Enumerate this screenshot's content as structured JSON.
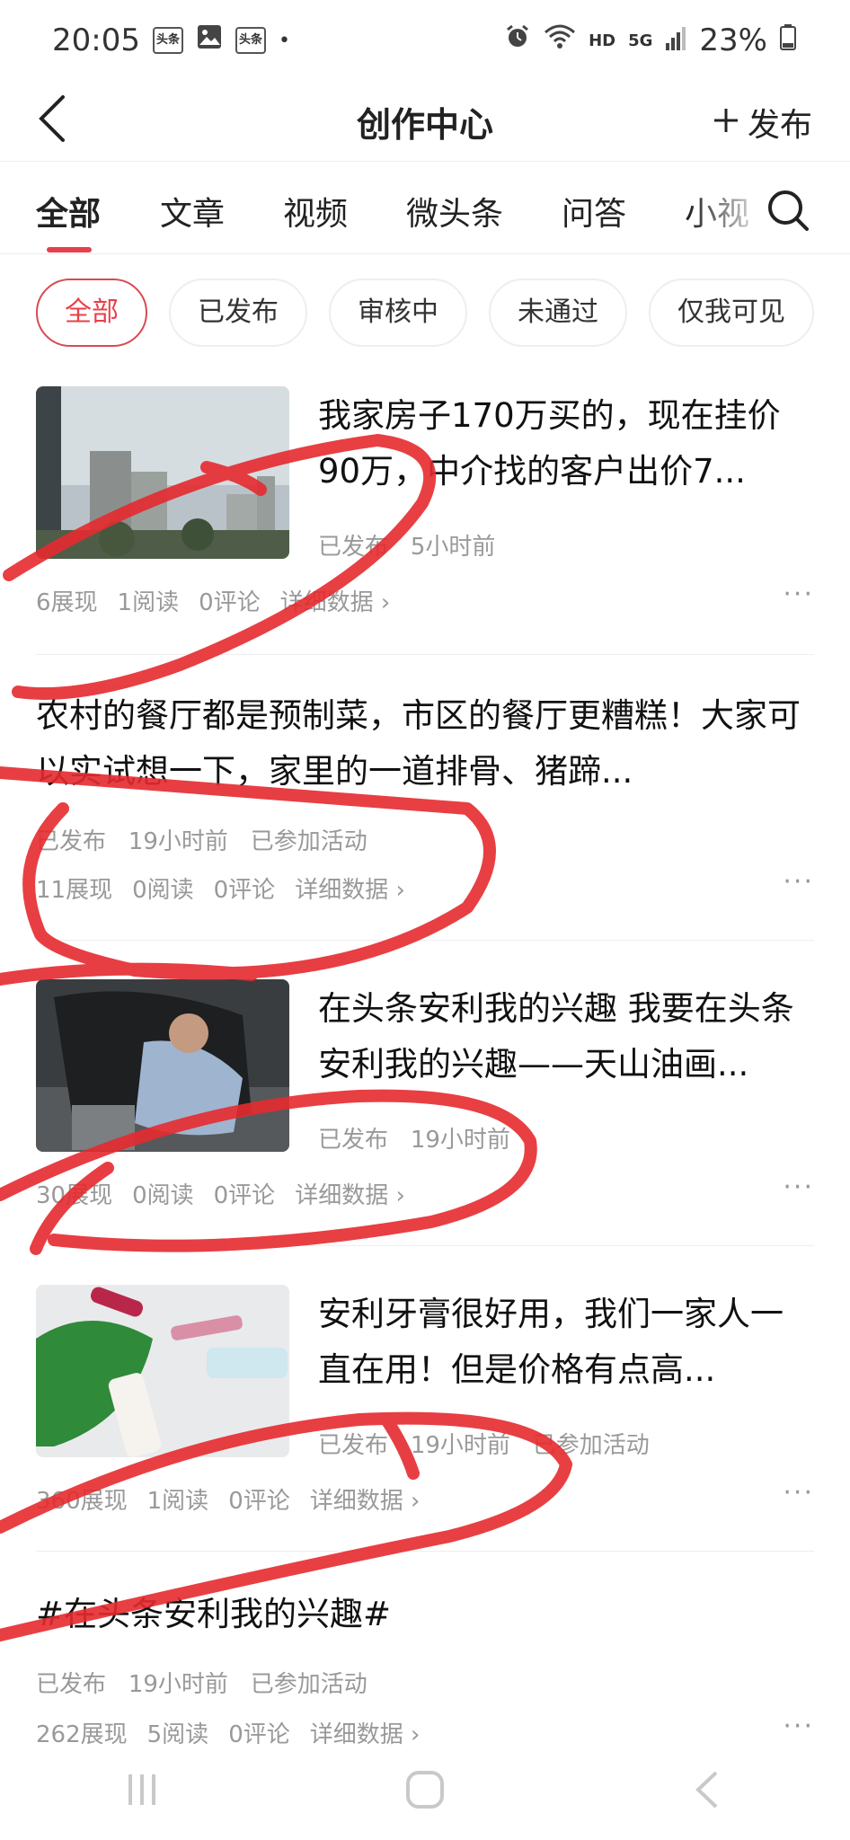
{
  "status_bar": {
    "time": "20:05",
    "badge1": "头条",
    "badge2": "头条",
    "dot": "•",
    "hd": "HD",
    "net": "5G",
    "battery": "23%"
  },
  "navbar": {
    "title": "创作中心",
    "publish_label": "发布"
  },
  "tabs": [
    "全部",
    "文章",
    "视频",
    "微头条",
    "问答",
    "小视"
  ],
  "filters": [
    "全部",
    "已发布",
    "审核中",
    "未通过",
    "仅我可见"
  ],
  "items": [
    {
      "title": "我家房子170万买的，现在挂价90万，中介找的客户出价7...",
      "status": "已发布",
      "time": "5小时前",
      "activity": "",
      "impressions": "6展现",
      "reads": "1阅读",
      "comments": "0评论",
      "details": "详细数据"
    },
    {
      "title": "农村的餐厅都是预制菜，市区的餐厅更糟糕！大家可以实试想一下，家里的一道排骨、猪蹄...",
      "status": "已发布",
      "time": "19小时前",
      "activity": "已参加活动",
      "impressions": "11展现",
      "reads": "0阅读",
      "comments": "0评论",
      "details": "详细数据"
    },
    {
      "title": "在头条安利我的兴趣 我要在头条安利我的兴趣——天山油画...",
      "status": "已发布",
      "time": "19小时前",
      "activity": "",
      "impressions": "30展现",
      "reads": "0阅读",
      "comments": "0评论",
      "details": "详细数据"
    },
    {
      "title": "安利牙膏很好用，我们一家人一直在用！但是价格有点高...",
      "status": "已发布",
      "time": "19小时前",
      "activity": "已参加活动",
      "impressions": "360展现",
      "reads": "1阅读",
      "comments": "0评论",
      "details": "详细数据"
    },
    {
      "title": "#在头条安利我的兴趣#",
      "status": "已发布",
      "time": "19小时前",
      "activity": "已参加活动",
      "impressions": "262展现",
      "reads": "5阅读",
      "comments": "0评论",
      "details": "详细数据"
    }
  ],
  "more_glyph": "···",
  "colors": {
    "accent": "#e8404a",
    "scribble": "#e52a2f",
    "meta": "#999999"
  }
}
